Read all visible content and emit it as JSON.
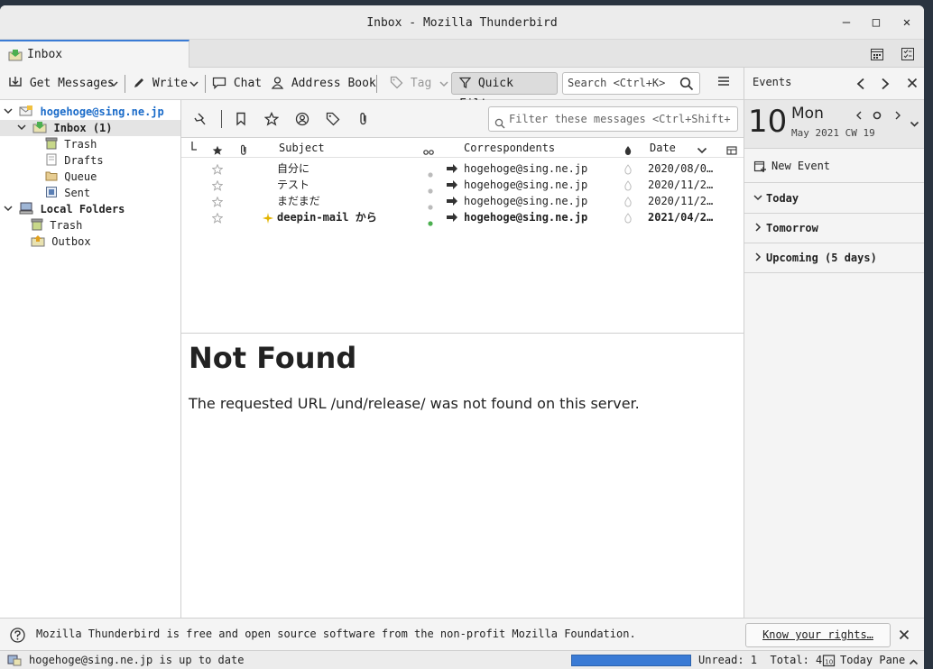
{
  "window": {
    "title": "Inbox - Mozilla Thunderbird"
  },
  "tabs": [
    {
      "label": "Inbox"
    }
  ],
  "toolbar": {
    "get_messages": "Get Messages",
    "write": "Write",
    "chat": "Chat",
    "address_book": "Address Book",
    "tag": "Tag",
    "quick_filter": "Quick Filter",
    "search_placeholder": "Search <Ctrl+K>"
  },
  "folders": {
    "account": "hogehoge@sing.ne.jp",
    "inbox": "Inbox (1)",
    "trash": "Trash",
    "drafts": "Drafts",
    "queue": "Queue",
    "sent": "Sent",
    "local_folders": "Local Folders",
    "local_trash": "Trash",
    "outbox": "Outbox"
  },
  "quickfilter": {
    "filter_placeholder": "Filter these messages <Ctrl+Shift+"
  },
  "columns": {
    "subject": "Subject",
    "correspondents": "Correspondents",
    "date": "Date"
  },
  "messages": [
    {
      "subject": "自分に",
      "correspondent": "hogehoge@sing.ne.jp",
      "date": "2020/08/0…",
      "unread": false
    },
    {
      "subject": "テスト",
      "correspondent": "hogehoge@sing.ne.jp",
      "date": "2020/11/2…",
      "unread": false
    },
    {
      "subject": "まだまだ",
      "correspondent": "hogehoge@sing.ne.jp",
      "date": "2020/11/2…",
      "unread": false
    },
    {
      "subject": "deepin-mail から",
      "correspondent": "hogehoge@sing.ne.jp",
      "date": "2021/04/2…",
      "unread": true
    }
  ],
  "message_body": {
    "heading": "Not Found",
    "text": "The requested URL /und/release/ was not found on this server."
  },
  "today_pane": {
    "header": "Events",
    "day_number": "10",
    "day_name": "Mon",
    "month_week": "May 2021 CW 19",
    "new_event": "New Event",
    "sections": [
      "Today",
      "Tomorrow",
      "Upcoming (5 days)"
    ]
  },
  "notification": {
    "message": "Mozilla Thunderbird is free and open source software from the non-profit Mozilla Foundation.",
    "button": "Know your rights…"
  },
  "statusbar": {
    "status": "hogehoge@sing.ne.jp is up to date",
    "progress_fraction": 1.0,
    "counts": "Unread: 1  Total: 4",
    "today_pane_label": "Today Pane"
  },
  "colors": {
    "accent": "#3a7bd5",
    "account_link": "#1a6bc9",
    "unread_dot": "#4caf50"
  }
}
